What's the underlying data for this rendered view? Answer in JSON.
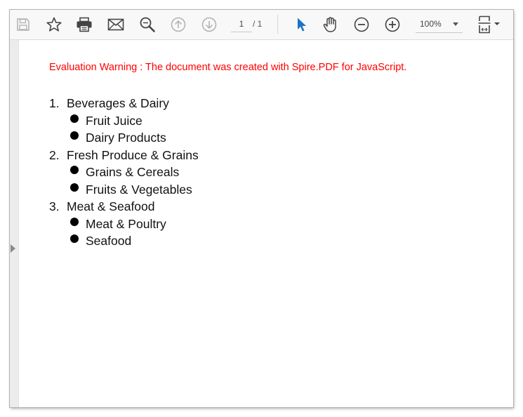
{
  "toolbar": {
    "page_current": "1",
    "page_total": "/ 1",
    "zoom": "100%",
    "icons": [
      "save-icon",
      "bookmark-star-icon",
      "print-icon",
      "email-icon",
      "search-icon",
      "previous-page-icon",
      "next-page-icon",
      "select-cursor-icon",
      "hand-pan-icon",
      "zoom-out-icon",
      "zoom-in-icon",
      "fit-page-icon"
    ],
    "accent_color": "#1a73c7"
  },
  "document": {
    "warning": "Evaluation Warning : The document was created with Spire.PDF for JavaScript.",
    "warning_color": "#ff0000",
    "categories": [
      {
        "number": "1.",
        "label": "Beverages & Dairy",
        "items": [
          "Fruit Juice",
          "Dairy Products"
        ]
      },
      {
        "number": "2.",
        "label": "Fresh Produce & Grains",
        "items": [
          "Grains & Cereals",
          "Fruits & Vegetables"
        ]
      },
      {
        "number": "3.",
        "label": "Meat & Seafood",
        "items": [
          "Meat & Poultry",
          "Seafood"
        ]
      }
    ]
  }
}
